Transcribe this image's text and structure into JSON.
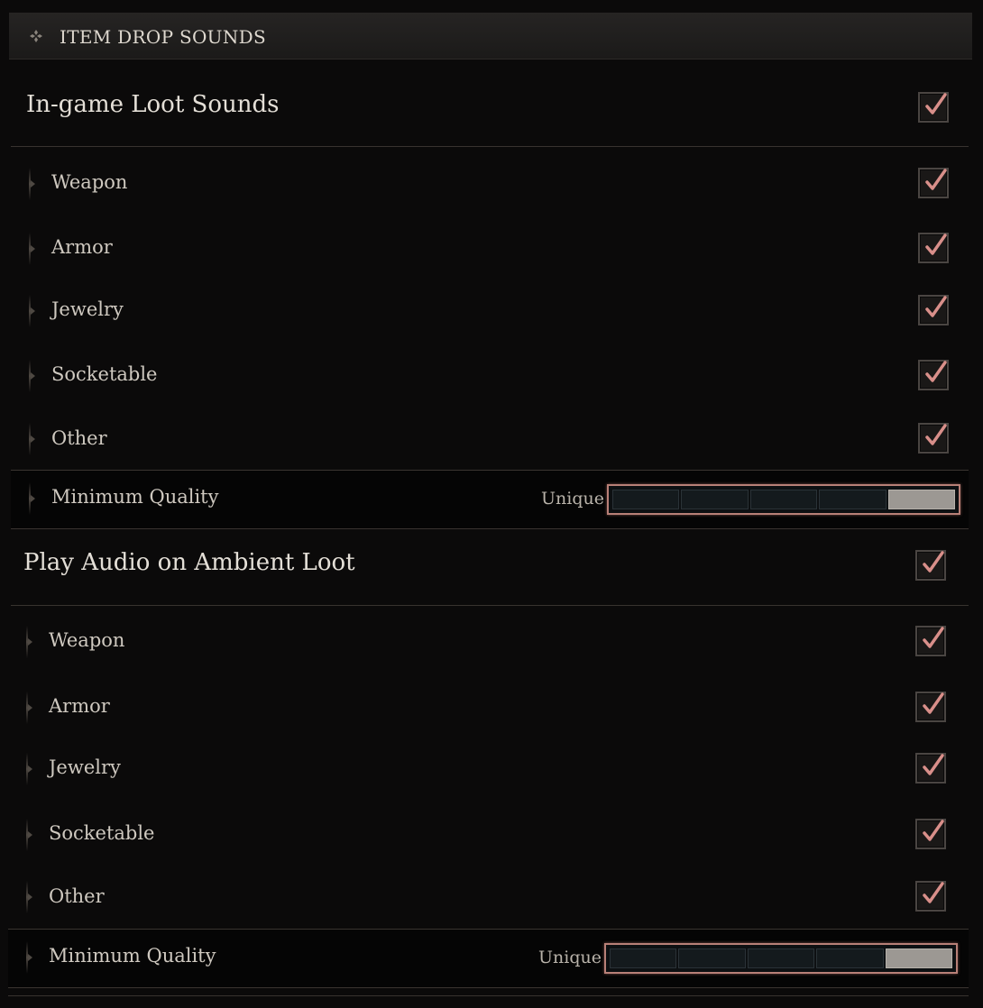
{
  "header": {
    "title": "ITEM DROP SOUNDS",
    "icon": "diamond-cluster-icon"
  },
  "sections": [
    {
      "title": "In-game Loot Sounds",
      "enabled": true,
      "items": [
        {
          "label": "Weapon",
          "checked": true
        },
        {
          "label": "Armor",
          "checked": true
        },
        {
          "label": "Jewelry",
          "checked": true
        },
        {
          "label": "Socketable",
          "checked": true
        },
        {
          "label": "Other",
          "checked": true
        }
      ],
      "min_quality": {
        "label": "Minimum Quality",
        "value": "Unique",
        "level": 5,
        "max": 5
      }
    },
    {
      "title": "Play Audio on Ambient Loot",
      "enabled": true,
      "items": [
        {
          "label": "Weapon",
          "checked": true
        },
        {
          "label": "Armor",
          "checked": true
        },
        {
          "label": "Jewelry",
          "checked": true
        },
        {
          "label": "Socketable",
          "checked": true
        },
        {
          "label": "Other",
          "checked": true
        }
      ],
      "min_quality": {
        "label": "Minimum Quality",
        "value": "Unique",
        "level": 5,
        "max": 5
      }
    }
  ],
  "colors": {
    "check": "#d98f8a",
    "slider_border": "#b88077",
    "slider_fill": "#9c9893"
  }
}
